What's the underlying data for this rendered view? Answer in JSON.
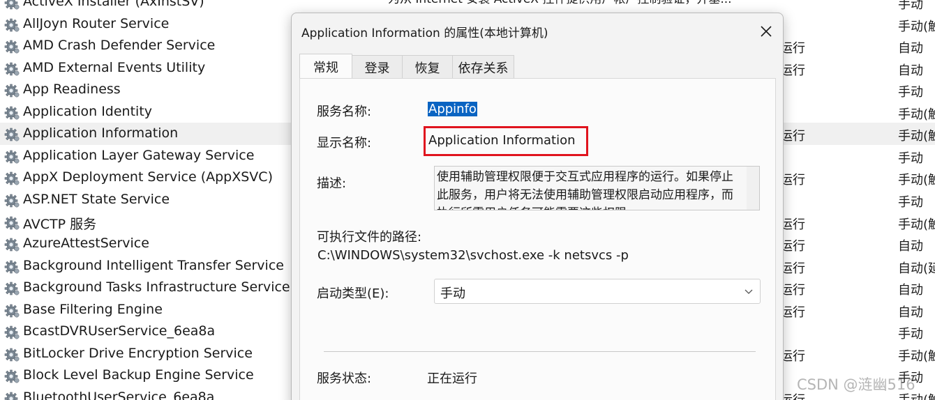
{
  "services": [
    {
      "name": "ActiveX Installer (AxInstSV)",
      "description": "为从 Internet 安装 ActiveX 控件提供用户帐户控制验证，并基...",
      "status": "",
      "startup": "手动"
    },
    {
      "name": "AllJoyn Router Service",
      "description": "",
      "status": "",
      "startup": "手动(触"
    },
    {
      "name": "AMD Crash Defender Service",
      "description": "",
      "status": "运行",
      "startup": "自动"
    },
    {
      "name": "AMD External Events Utility",
      "description": "",
      "status": "运行",
      "startup": "自动"
    },
    {
      "name": "App Readiness",
      "description": "",
      "status": "",
      "startup": "手动"
    },
    {
      "name": "Application Identity",
      "description": "",
      "status": "",
      "startup": "手动(触"
    },
    {
      "name": "Application Information",
      "description": "",
      "status": "运行",
      "startup": "手动(触"
    },
    {
      "name": "Application Layer Gateway Service",
      "description": "",
      "status": "",
      "startup": "手动"
    },
    {
      "name": "AppX Deployment Service (AppXSVC)",
      "description": "",
      "status": "运行",
      "startup": "手动(触"
    },
    {
      "name": "ASP.NET State Service",
      "description": "",
      "status": "",
      "startup": "手动"
    },
    {
      "name": "AVCTP 服务",
      "description": "",
      "status": "运行",
      "startup": "手动(触"
    },
    {
      "name": "AzureAttestService",
      "description": "",
      "status": "运行",
      "startup": "自动"
    },
    {
      "name": "Background Intelligent Transfer Service",
      "description": "",
      "status": "运行",
      "startup": "自动(延"
    },
    {
      "name": "Background Tasks Infrastructure Service",
      "description": "",
      "status": "运行",
      "startup": "自动"
    },
    {
      "name": "Base Filtering Engine",
      "description": "",
      "status": "运行",
      "startup": "自动"
    },
    {
      "name": "BcastDVRUserService_6ea8a",
      "description": "",
      "status": "",
      "startup": "手动"
    },
    {
      "name": "BitLocker Drive Encryption Service",
      "description": "",
      "status": "运行",
      "startup": "手动(触"
    },
    {
      "name": "Block Level Backup Engine Service",
      "description": "",
      "status": "",
      "startup": "手动"
    },
    {
      "name": "BluetoothUserService_6ea8a",
      "description": "",
      "status": "运行",
      "startup": "手动(触"
    }
  ],
  "dialog": {
    "title": "Application Information 的属性(本地计算机)",
    "tabs": [
      "常规",
      "登录",
      "恢复",
      "依存关系"
    ],
    "service_name_label": "服务名称:",
    "service_name_value": "Appinfo",
    "display_name_label": "显示名称:",
    "display_name_value": "Application Information",
    "description_label": "描述:",
    "description_text": "使用辅助管理权限便于交互式应用程序的运行。如果停止此服务，用户将无法使用辅助管理权限启动应用程序，而执行所需用户任务可能需要这些权限。",
    "exe_path_label": "可执行文件的路径:",
    "exe_path_value": "C:\\WINDOWS\\system32\\svchost.exe -k netsvcs -p",
    "startup_type_label": "启动类型(E):",
    "startup_type_value": "手动",
    "service_status_label": "服务状态:",
    "service_status_value": "正在运行"
  },
  "watermark": "CSDN @涟幽516",
  "colors": {
    "selection_highlight": "#0a64c2",
    "annotation_box": "#e0141e"
  }
}
